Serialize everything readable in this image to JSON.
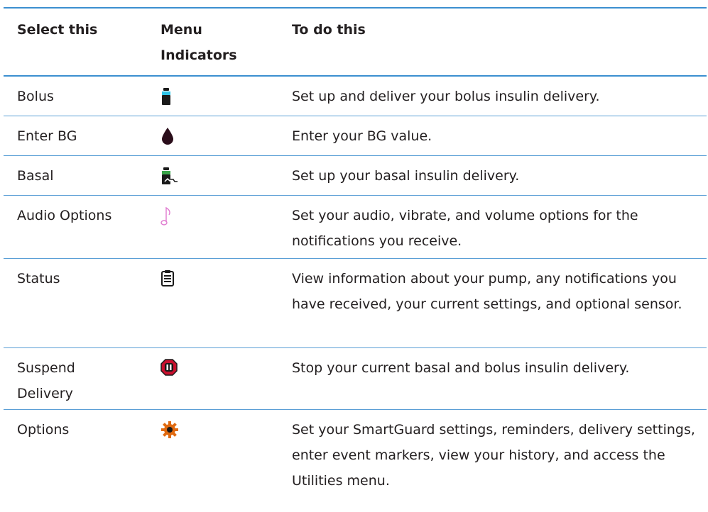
{
  "header": {
    "col1": "Select this",
    "col2_line1": "Menu",
    "col2_line2": "Indicators",
    "col3": "To do this"
  },
  "rows": [
    {
      "select": "Bolus",
      "icon": "bolus-vial-icon",
      "description": "Set up and deliver your bolus insulin delivery."
    },
    {
      "select": "Enter BG",
      "icon": "blood-drop-icon",
      "description": "Enter your BG value."
    },
    {
      "select": "Basal",
      "icon": "basal-vial-icon",
      "description": "Set up your basal insulin delivery."
    },
    {
      "select": "Audio Options",
      "icon": "music-note-icon",
      "description": "Set your audio, vibrate, and volume options for the notifications you receive."
    },
    {
      "select": "Status",
      "icon": "clipboard-icon",
      "description": "View information about your pump, any notifications you have received, your current settings, and optional sensor."
    },
    {
      "select_line1": "Suspend",
      "select_line2": "Delivery",
      "icon": "stop-pause-icon",
      "description": "Stop your current basal and bolus insulin delivery."
    },
    {
      "select": "Options",
      "icon": "gear-icon",
      "description": "Set your SmartGuard settings, reminders, delivery settings, enter event markers, view your history, and access the Utilities menu."
    }
  ],
  "colors": {
    "rule": "#3b8fd0",
    "bolus": "#2ec4e8",
    "drop": "#2a0d1a",
    "basal": "#3aa64a",
    "note": "#e07bd0",
    "gear": "#e06a10"
  }
}
